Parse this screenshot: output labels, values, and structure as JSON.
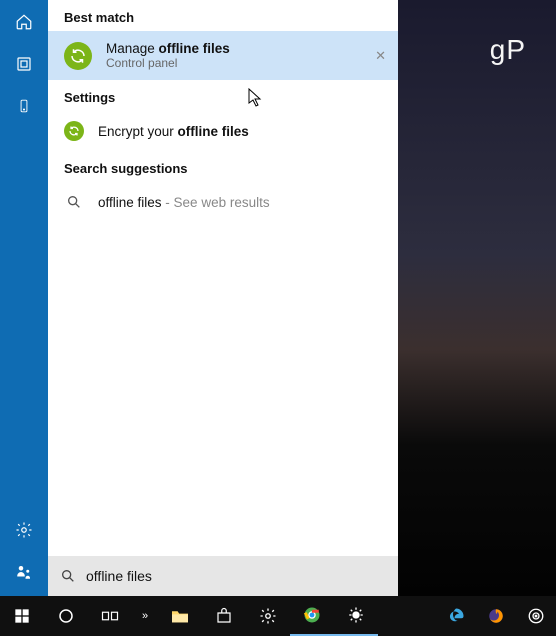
{
  "watermark": "gP",
  "section_best_match": "Best match",
  "section_settings": "Settings",
  "section_suggestions": "Search suggestions",
  "best_match": {
    "title_pre": "Manage ",
    "title_bold": "offline files",
    "subtitle": "Control panel"
  },
  "settings_item": {
    "title_pre": "Encrypt your ",
    "title_bold": "offline files"
  },
  "suggestion": {
    "text": "offline files",
    "suffix": " - See web results"
  },
  "search": {
    "value": "offline files"
  }
}
